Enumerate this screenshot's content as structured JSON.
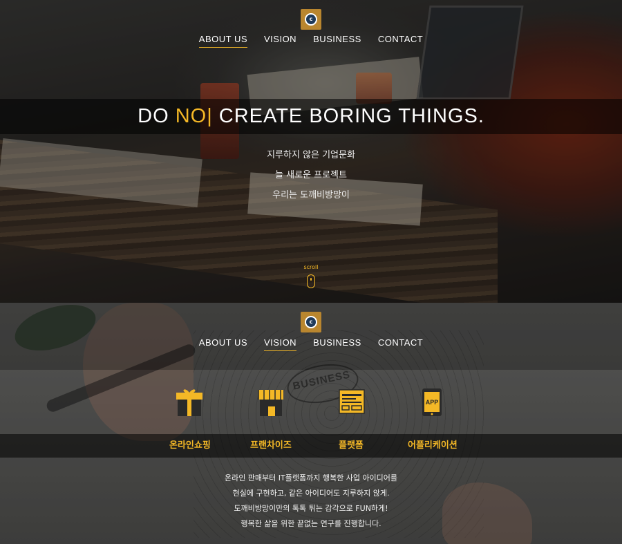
{
  "hero": {
    "nav": [
      "ABOUT US",
      "VISION",
      "BUSINESS",
      "CONTACT"
    ],
    "active_nav": "ABOUT US",
    "headline": {
      "part1": "DO ",
      "highlight": "NO|",
      "part2": " CREATE BORING THINGS."
    },
    "slogans": [
      "지루하지 않은 기업문화",
      "늘 새로운 프로젝트",
      "우리는 도깨비방망이"
    ],
    "scroll_label": "scroll"
  },
  "business": {
    "nav": [
      "ABOUT US",
      "VISION",
      "BUSINESS",
      "CONTACT"
    ],
    "active_nav": "VISION",
    "sketch_word": "BUSINESS",
    "categories": [
      {
        "label": "온라인쇼핑",
        "icon": "gift-box-icon"
      },
      {
        "label": "프랜차이즈",
        "icon": "storefront-icon"
      },
      {
        "label": "플랫폼",
        "icon": "browser-window-icon"
      },
      {
        "label": "어플리케이션",
        "icon": "smartphone-app-icon",
        "icon_text": "APP"
      }
    ],
    "description": [
      "온라인 판매부터 IT플랫폼까지 행복한 사업 아이디어를",
      "현실에 구현하고, 같은 아이디어도 지루하지 않게.",
      "도깨비방망이만의 톡톡 튀는 감각으로 FUN하게!",
      "행복한 삶을 위한 끝없는 연구를 진행합니다."
    ]
  },
  "colors": {
    "accent": "#f4b826",
    "logo_bg": "#b9862f"
  }
}
